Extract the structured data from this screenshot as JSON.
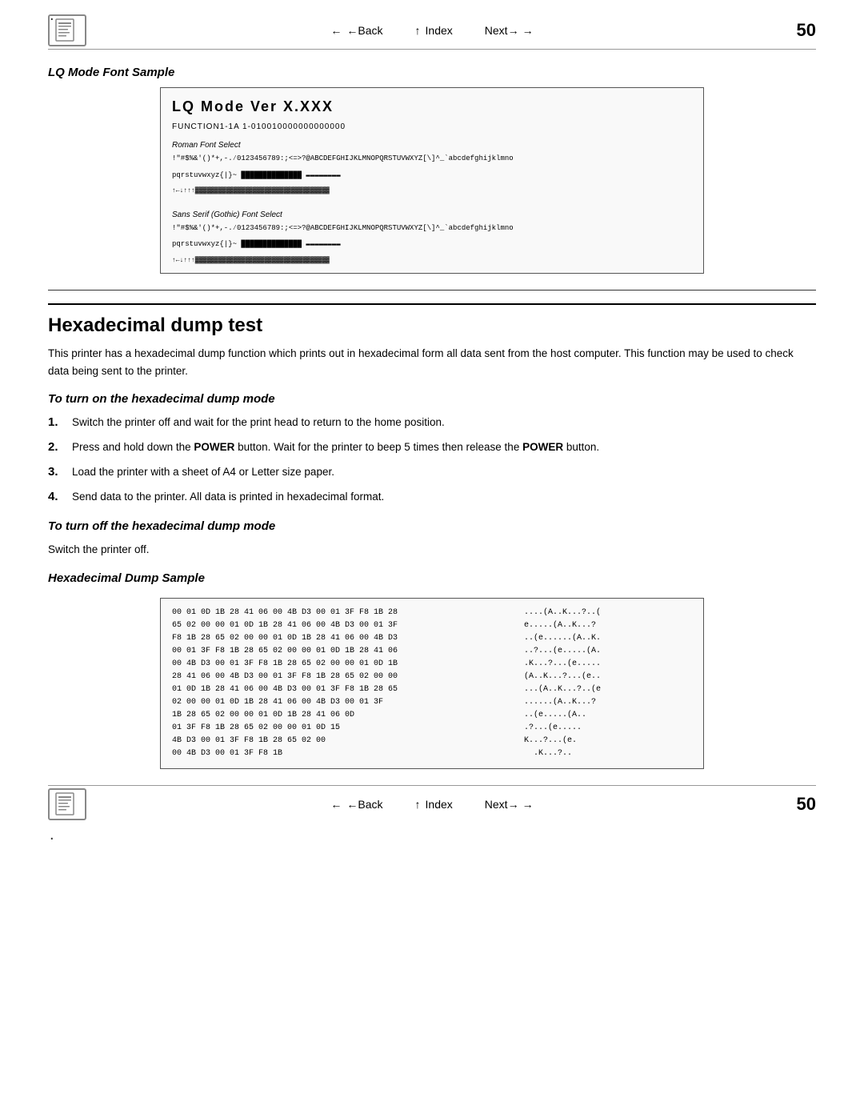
{
  "page": {
    "number": "50",
    "dot_top": ".",
    "dot_bottom": "."
  },
  "nav": {
    "back_label": "←Back",
    "index_label": "↑ Index",
    "next_label": "Next→"
  },
  "lq_section": {
    "title": "LQ Mode Font Sample",
    "box": {
      "heading": "LQ Mode   Ver X.XXX",
      "func_line": "FUNCTION1-1A   1-010010000000000000",
      "roman_label": "Roman Font Select",
      "roman_chars1": "!\"#$%&'()*+,-.⁄0123456789:;<=>?@ABCDEFGHIJKLMNOPQRSTUVWXYZ[\\]^_`abcdefghijklmno",
      "roman_chars2": "pqrstuvwxyz{|}~ □□□□□□□□□□□□□□□□□□□□□□□□□□□□□□□□□□",
      "roman_chars3": "↑←↓↑↑↑↑↑↑↑↑↑↑↑↑↑↑↑↑↑↑↑↑↑↑↑↑↑↑↑↑↑",
      "sans_label": "Sans Serif (Gothic) Font Select",
      "sans_chars1": "!\"#$%&'()*+,-.⁄0123456789:;<=>?@ABCDEFGHIJKLMNOPQRSTUVWXYZ[\\]^_`abcdefghijklmno",
      "sans_chars2": "pqrstuvwxyz{|}~ □□□□□□□□□□□□□□□□□□□□□□□□□□□□□□□□□□",
      "sans_chars3": "↑←↓↑↑↑↑↑↑↑↑↑↑↑↑↑↑↑↑↑↑↑↑↑↑↑↑↑↑↑↑↑"
    }
  },
  "hexadecimal": {
    "heading": "Hexadecimal dump test",
    "intro": "This printer has a hexadecimal dump function which prints out in hexadecimal form all data sent from the host computer. This function may be used to check data being sent to the printer.",
    "turn_on_title": "To turn on the hexadecimal dump mode",
    "steps_on": [
      {
        "num": "1.",
        "text": "Switch the printer off and wait for the print head to return to the home position."
      },
      {
        "num": "2.",
        "text": "Press and hold down the POWER button. Wait for the printer to beep 5 times then release the POWER button.",
        "bold_words": [
          "POWER",
          "POWER"
        ]
      },
      {
        "num": "3.",
        "text": "Load the printer with a sheet of A4 or Letter size paper."
      },
      {
        "num": "4.",
        "text": "Send data to the printer. All data is printed in hexadecimal format."
      }
    ],
    "turn_off_title": "To turn off the hexadecimal dump mode",
    "turn_off_text": "Switch the printer off.",
    "sample_title": "Hexadecimal Dump Sample",
    "hex_rows": [
      {
        "hex": "00 01 0D 1B 28 41 06 00  4B D3 00 01 3F F8 1B 28",
        "ascii": "....(A..K...?..("
      },
      {
        "hex": "65 02 00 00 01 0D 1B 28  41 06 00 4B D3 00 01 3F",
        "ascii": "e.....(A..K...?"
      },
      {
        "hex": "F8 1B 28 65 02 00 00 01  0D 1B 28 41 06 00 4B D3",
        "ascii": "..(e......(A..K."
      },
      {
        "hex": "00 01 3F F8 1B 28 65 02  00 00 01 0D 1B 28 41 06",
        "ascii": "..?...(e.....(A."
      },
      {
        "hex": "00 4B D3 00 01 3F F8 1B  28 65 02 00 00 01 0D 1B",
        "ascii": ".K...?...(e....."
      },
      {
        "hex": "28 41 06 00 4B D3 00 01  3F F8 1B 28 65 02 00 00",
        "ascii": "(A..K...?...(e.."
      },
      {
        "hex": "01 0D 1B 28 41 06 00 4B  D3 00 01 3F F8 1B 28 65",
        "ascii": "...(A..K...?..("
      },
      {
        "hex": "02 00 00 01 0D 1B 28 41  06 00 4B D3 00 01 3F",
        "ascii": "......(A..K...?"
      },
      {
        "hex": "1B 28 65 02 00 00 01 0D  1B 28 41 06 0D",
        "ascii": "..(e.....(A.."
      },
      {
        "hex": "01 3F F8 1B 28 65 02 00  00 01 0D 15",
        "ascii": ".?...(e....."
      },
      {
        "hex": "4B D3 00 01 3F F8 1B 28  65 02 00",
        "ascii": "K...?...(e."
      },
      {
        "hex": "   00 4B D3 00 01 3F F8  1B",
        "ascii": "  .K...?.."
      }
    ]
  }
}
